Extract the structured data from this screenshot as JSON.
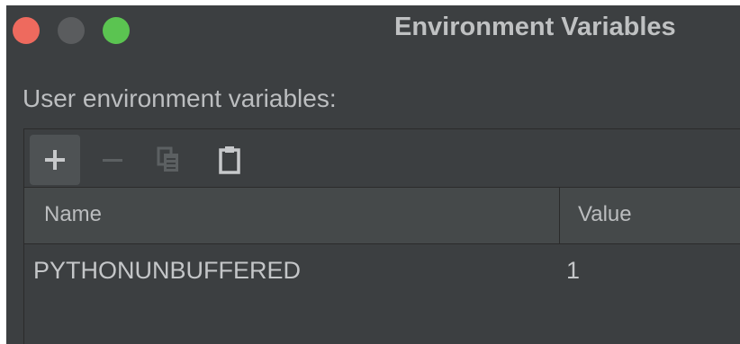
{
  "window": {
    "title": "Environment Variables"
  },
  "section": {
    "label": "User environment variables:"
  },
  "toolbar": {
    "buttons": [
      {
        "icon": "add-icon",
        "enabled": true
      },
      {
        "icon": "remove-icon",
        "enabled": false
      },
      {
        "icon": "copy-icon",
        "enabled": false
      },
      {
        "icon": "paste-icon",
        "enabled": true
      }
    ]
  },
  "table": {
    "columns": [
      "Name",
      "Value"
    ],
    "rows": [
      {
        "name": "PYTHONUNBUFFERED",
        "value": "1"
      }
    ]
  },
  "colors": {
    "background": "#3c3f41",
    "header": "#45494a",
    "close": "#ee6a5e",
    "zoom": "#5bc451"
  }
}
